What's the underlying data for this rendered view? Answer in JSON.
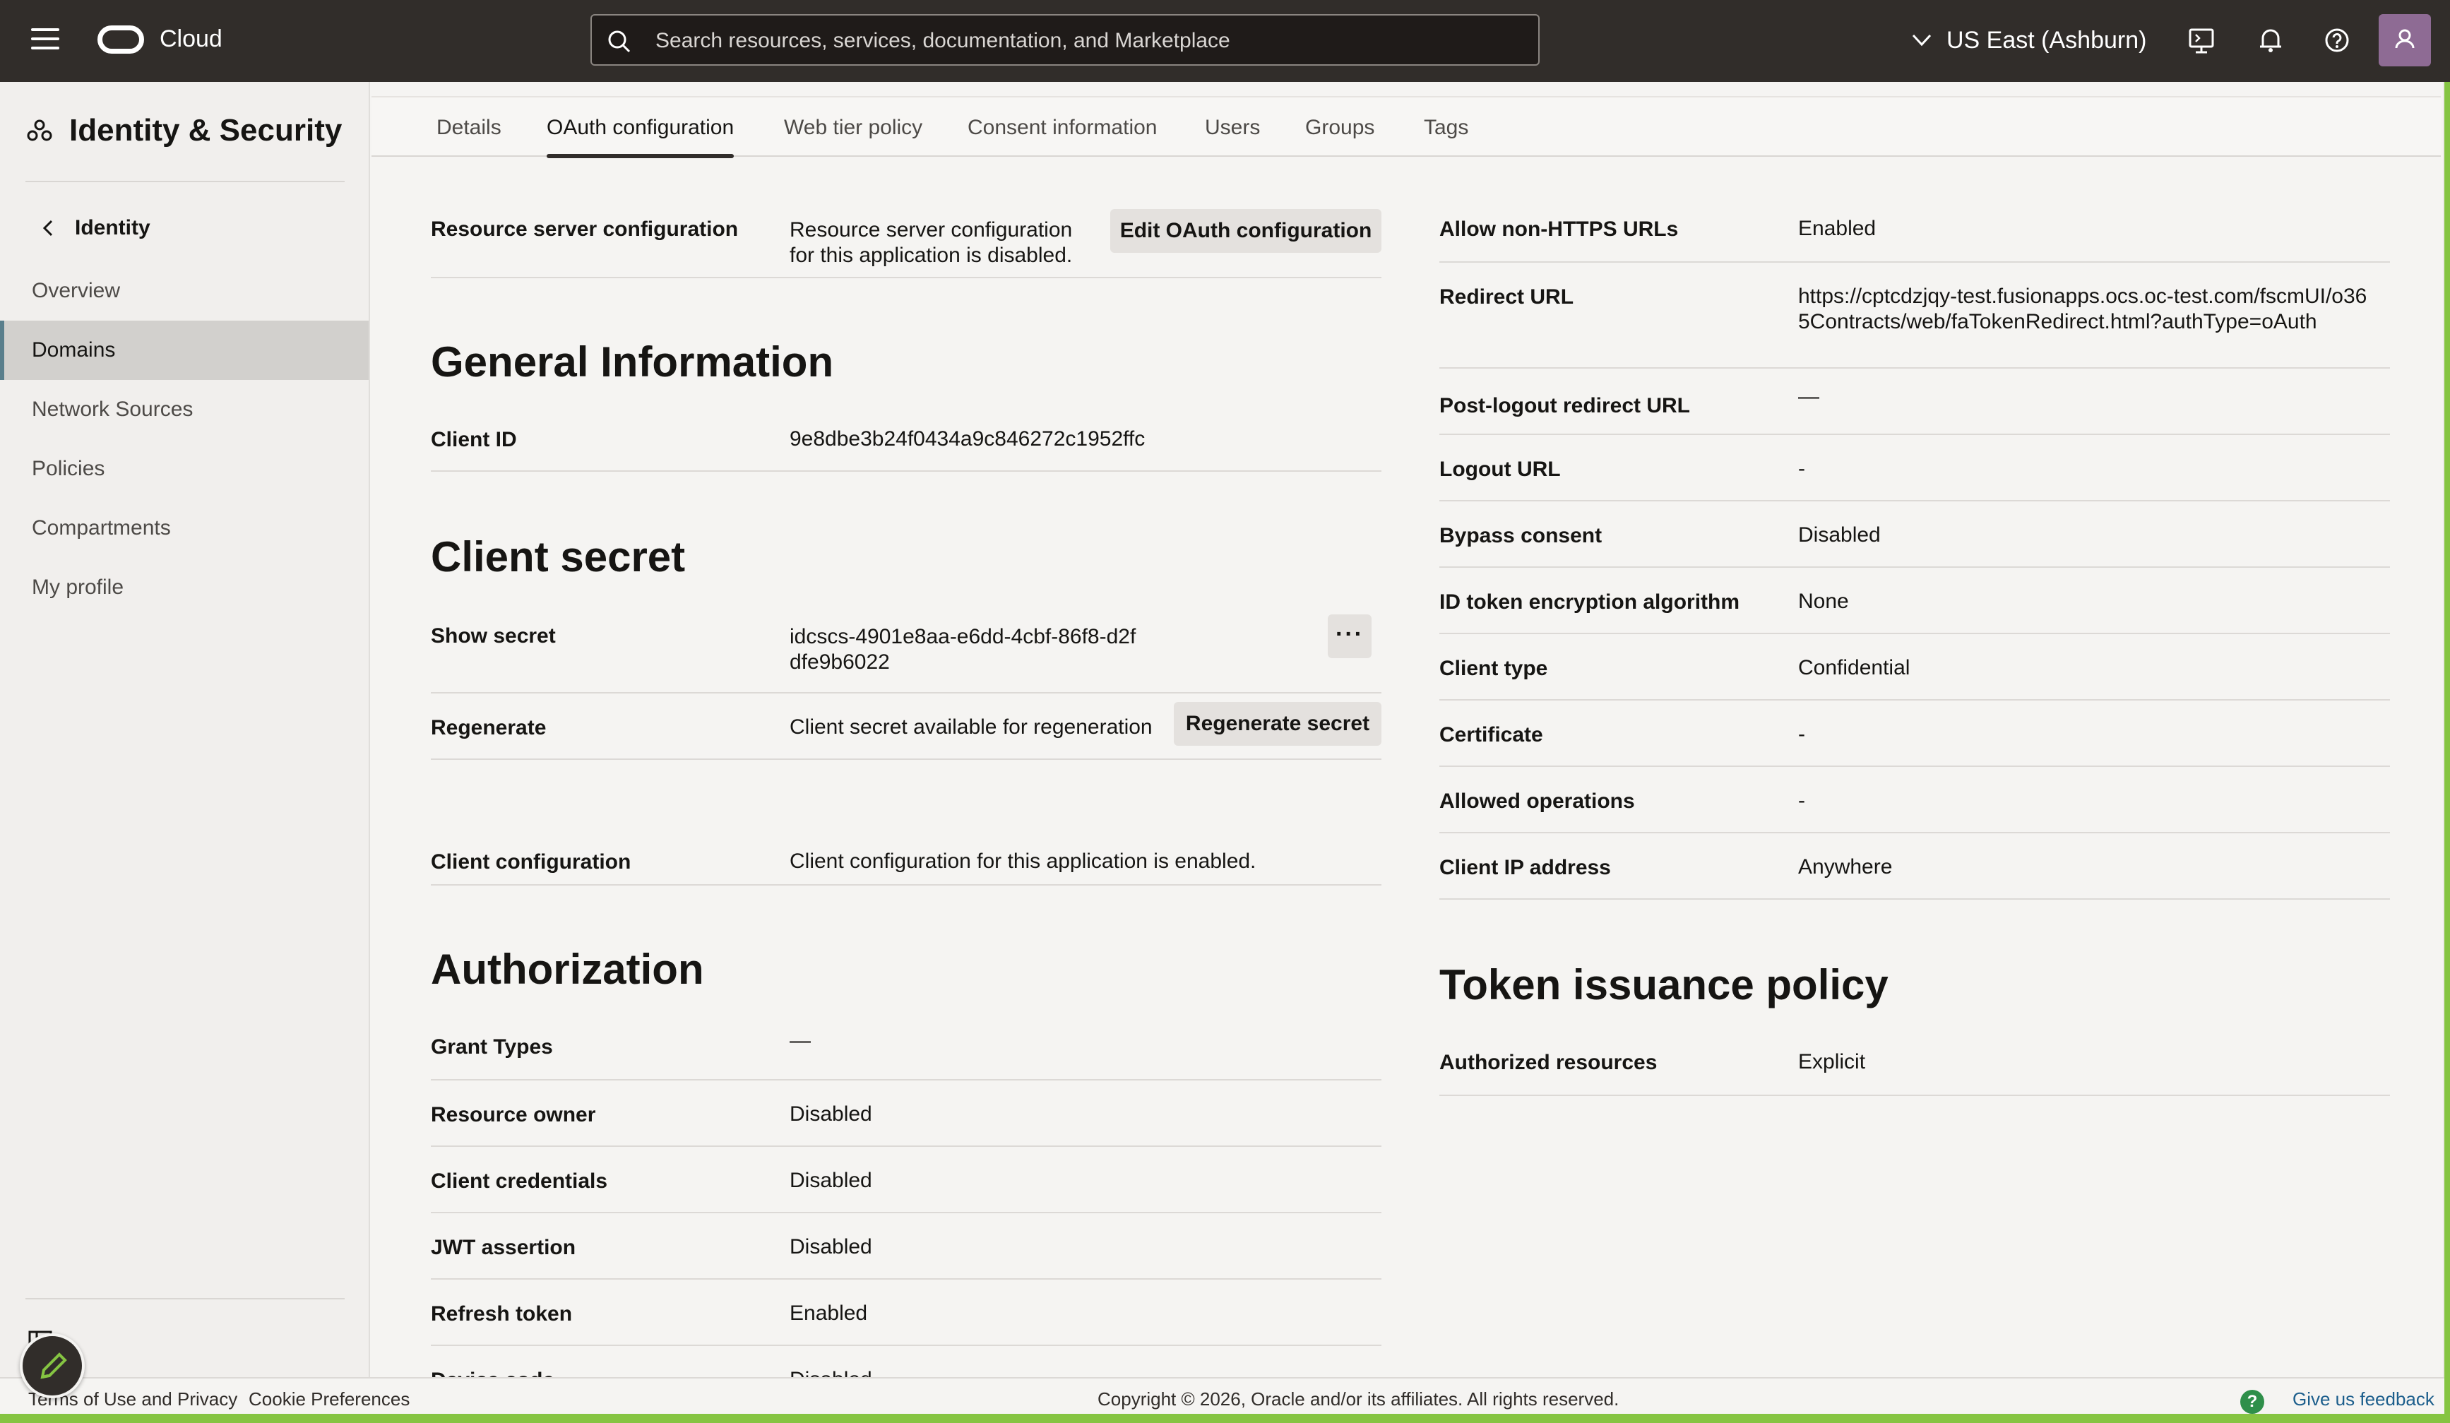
{
  "topbar": {
    "brand": "Cloud",
    "search_placeholder": "Search resources, services, documentation, and Marketplace",
    "region": "US East (Ashburn)"
  },
  "sidebar": {
    "title": "Identity & Security",
    "back_label": "Identity",
    "items": [
      {
        "label": "Overview"
      },
      {
        "label": "Domains",
        "active": true
      },
      {
        "label": "Network Sources"
      },
      {
        "label": "Policies"
      },
      {
        "label": "Compartments"
      },
      {
        "label": "My profile"
      }
    ]
  },
  "tabs": [
    "Details",
    "OAuth configuration",
    "Web tier policy",
    "Consent information",
    "Users",
    "Groups",
    "Tags"
  ],
  "active_tab": "OAuth configuration",
  "left": {
    "resource_server": {
      "label": "Resource server configuration",
      "value": "Resource server configuration for this application is disabled.",
      "button": "Edit OAuth configuration"
    },
    "general_heading": "General Information",
    "client_id": {
      "label": "Client ID",
      "value": "9e8dbe3b24f0434a9c846272c1952ffc"
    },
    "secret_heading": "Client secret",
    "show_secret": {
      "label": "Show secret",
      "value": "idcscs-4901e8aa-e6dd-4cbf-86f8-d2fdfe9b6022",
      "more": "···"
    },
    "regenerate": {
      "label": "Regenerate",
      "value": "Client secret available for regeneration",
      "button": "Regenerate secret"
    },
    "client_config": {
      "label": "Client configuration",
      "value": "Client configuration for this application is enabled."
    },
    "authorization_heading": "Authorization",
    "grant_types": {
      "label": "Grant Types",
      "value": "—"
    },
    "resource_owner": {
      "label": "Resource owner",
      "value": "Disabled"
    },
    "client_credentials": {
      "label": "Client credentials",
      "value": "Disabled"
    },
    "jwt_assertion": {
      "label": "JWT assertion",
      "value": "Disabled"
    },
    "refresh_token": {
      "label": "Refresh token",
      "value": "Enabled"
    },
    "device_code": {
      "label": "Device code",
      "value": "Disabled"
    }
  },
  "right": {
    "allow_non_https": {
      "label": "Allow non-HTTPS URLs",
      "value": "Enabled"
    },
    "redirect_url": {
      "label": "Redirect URL",
      "value": "https://cptcdzjqy-test.fusionapps.ocs.oc-test.com/fscmUI/o365Contracts/web/faTokenRedirect.html?authType=oAuth"
    },
    "post_logout": {
      "label": "Post-logout redirect URL",
      "value": "—"
    },
    "logout_url": {
      "label": "Logout URL",
      "value": "-"
    },
    "bypass_consent": {
      "label": "Bypass consent",
      "value": "Disabled"
    },
    "id_token_enc": {
      "label": "ID token encryption algorithm",
      "value": "None"
    },
    "client_type": {
      "label": "Client type",
      "value": "Confidential"
    },
    "certificate": {
      "label": "Certificate",
      "value": "-"
    },
    "allowed_ops": {
      "label": "Allowed operations",
      "value": "-"
    },
    "client_ip": {
      "label": "Client IP address",
      "value": "Anywhere"
    },
    "token_heading": "Token issuance policy",
    "authorized_resources": {
      "label": "Authorized resources",
      "value": "Explicit"
    }
  },
  "footer": {
    "terms": "Terms of Use and Privacy",
    "cookies": "Cookie Preferences",
    "copyright": "Copyright © 2026, Oracle and/or its affiliates. All rights reserved.",
    "feedback": "Give us feedback",
    "help": "?"
  }
}
